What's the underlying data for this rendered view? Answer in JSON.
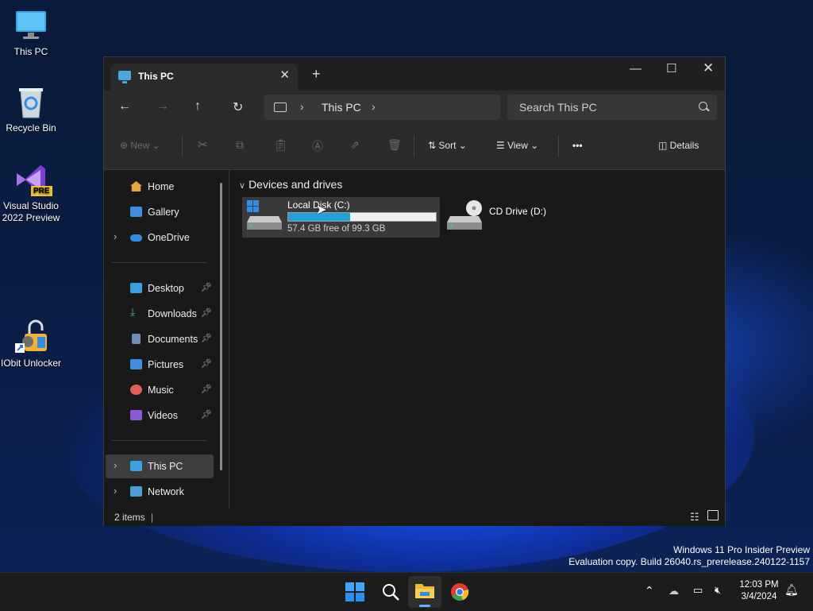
{
  "desktop": {
    "icons": [
      {
        "label": "This PC"
      },
      {
        "label": "Recycle Bin"
      },
      {
        "label": "Visual Studio 2022 Preview",
        "badge": "PRE"
      },
      {
        "label": "IObit Unlocker"
      }
    ],
    "watermark": {
      "line1": "Windows 11 Pro Insider Preview",
      "line2": "Evaluation copy. Build 26040.rs_prerelease.240122-1157"
    }
  },
  "window": {
    "tab_title": "This PC",
    "address": {
      "crumb": "This PC"
    },
    "search_placeholder": "Search This PC",
    "toolbar": {
      "new_label": "New",
      "sort_label": "Sort",
      "view_label": "View",
      "more_label": "•••",
      "details_label": "Details"
    },
    "sidebar": {
      "top": [
        {
          "label": "Home",
          "color": "#e8a33d"
        },
        {
          "label": "Gallery",
          "color": "#3b8ee0"
        },
        {
          "label": "OneDrive",
          "color": "#2f8fe6"
        }
      ],
      "pinned": [
        {
          "label": "Desktop",
          "color": "#3aa0e0"
        },
        {
          "label": "Downloads",
          "color": "#38b06a"
        },
        {
          "label": "Documents",
          "color": "#6f8fb8"
        },
        {
          "label": "Pictures",
          "color": "#3d8fe0"
        },
        {
          "label": "Music",
          "color": "#e0605a"
        },
        {
          "label": "Videos",
          "color": "#8a5ad8"
        }
      ],
      "bottom": [
        {
          "label": "This PC",
          "color": "#3aa0e0"
        },
        {
          "label": "Network",
          "color": "#4aa0d0"
        }
      ]
    },
    "group_title": "Devices and drives",
    "drives": [
      {
        "name": "Local Disk (C:)",
        "free_text": "57.4 GB free of 99.3 GB",
        "used_fraction": 0.42
      },
      {
        "name": "CD Drive (D:)"
      }
    ],
    "status": {
      "items": "2 items"
    }
  },
  "taskbar": {
    "time": "12:03 PM",
    "date": "3/4/2024"
  },
  "colors": {
    "accent": "#26a0da",
    "window_bg": "#191919"
  }
}
